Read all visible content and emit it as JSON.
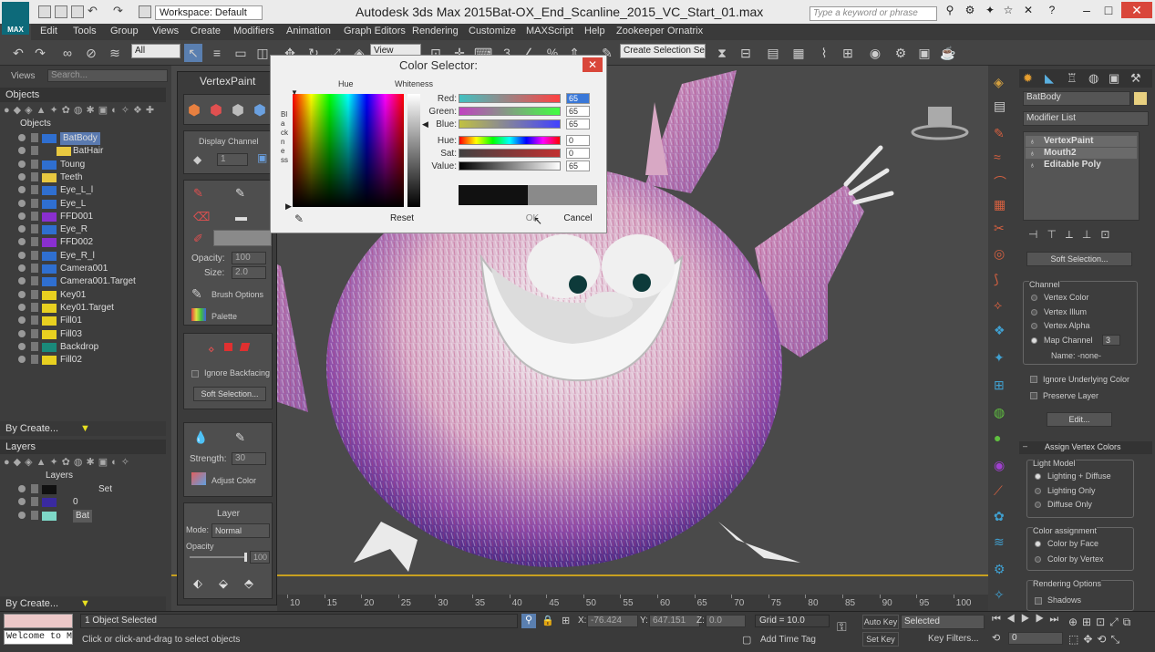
{
  "titlebar": {
    "app_title": "Autodesk 3ds Max 2015",
    "file_title": "Bat-OX_End_Scanline_2015_VC_Start_01.max",
    "logo_text": "MAX",
    "workspace": "Workspace: Default",
    "search_placeholder": "Type a keyword or phrase"
  },
  "menubar": [
    "Edit",
    "Tools",
    "Group",
    "Views",
    "Create",
    "Modifiers",
    "Animation",
    "Graph Editors",
    "Rendering",
    "Customize",
    "MAXScript",
    "Help",
    "Zookeeper",
    "Ornatrix"
  ],
  "toolbar": {
    "filter_select": "All",
    "view_select": "View",
    "selection_set": "Create Selection Se"
  },
  "scene_explorer": {
    "views_label": "Views",
    "search_placeholder": "Search...",
    "objects_tab": "Objects",
    "root": "Objects",
    "items": [
      {
        "label": "BatBody",
        "color": "#2f6fd0",
        "selected": true
      },
      {
        "label": "BatHair",
        "color": "#e8c840",
        "selected": false
      },
      {
        "label": "Toung",
        "color": "#2f6fd0",
        "selected": false
      },
      {
        "label": "Teeth",
        "color": "#e8c840",
        "selected": false
      },
      {
        "label": "Eye_L_l",
        "color": "#2f6fd0",
        "selected": false
      },
      {
        "label": "Eye_L",
        "color": "#2f6fd0",
        "selected": false
      },
      {
        "label": "FFD001",
        "color": "#8a2fd0",
        "selected": false
      },
      {
        "label": "Eye_R",
        "color": "#2f6fd0",
        "selected": false
      },
      {
        "label": "FFD002",
        "color": "#8a2fd0",
        "selected": false
      },
      {
        "label": "Eye_R_l",
        "color": "#2f6fd0",
        "selected": false
      },
      {
        "label": "Camera001",
        "color": "#2f6fd0",
        "selected": false
      },
      {
        "label": "Camera001.Target",
        "color": "#2f6fd0",
        "selected": false
      },
      {
        "label": "Key01",
        "color": "#e8d020",
        "selected": false
      },
      {
        "label": "Key01.Target",
        "color": "#e8d020",
        "selected": false
      },
      {
        "label": "Fill01",
        "color": "#e8d020",
        "selected": false
      },
      {
        "label": "Fill03",
        "color": "#e8d020",
        "selected": false
      },
      {
        "label": "Backdrop",
        "color": "#1a8a7a",
        "selected": false
      },
      {
        "label": "Fill02",
        "color": "#e8d020",
        "selected": false
      }
    ],
    "by_create": "By Create...",
    "layers_title": "Layers",
    "layers_root": "Layers",
    "layers": [
      {
        "label": "Set",
        "color": "#111111"
      },
      {
        "label": "0",
        "color": "#3a2aa0"
      },
      {
        "label": "Bat",
        "color": "#7ed8c8"
      }
    ],
    "by_create_2": "By Create..."
  },
  "vertexpaint": {
    "title": "VertexPaint",
    "display_channel": "Display Channel",
    "channel_value": "1",
    "opacity_label": "Opacity:",
    "opacity_value": "100",
    "size_label": "Size:",
    "size_value": "2.0",
    "brush_options": "Brush Options",
    "palette": "Palette",
    "ignore_backfacing": "Ignore Backfacing",
    "soft_selection": "Soft Selection...",
    "strength_label": "Strength:",
    "strength_value": "30",
    "adjust_color": "Adjust Color",
    "layer_title": "Layer",
    "mode_label": "Mode:",
    "mode_value": "Normal",
    "layer_opacity_label": "Opacity",
    "layer_opacity_value": "100"
  },
  "color_selector": {
    "title": "Color Selector:",
    "hue_label": "Hue",
    "whiteness_label": "Whiteness",
    "blackness_label": "Blackness",
    "red_label": "Red:",
    "green_label": "Green:",
    "blue_label": "Blue:",
    "hue2_label": "Hue:",
    "sat_label": "Sat:",
    "value_label": "Value:",
    "red": "65",
    "green": "65",
    "blue": "65",
    "hue": "0",
    "sat": "0",
    "value": "65",
    "reset": "Reset",
    "ok": "OK",
    "cancel": "Cancel",
    "old_color": "#111111",
    "new_color": "#8a8a8a"
  },
  "modify_panel": {
    "object_name": "BatBody",
    "object_color": "#e8d080",
    "modifier_list": "Modifier List",
    "stack": [
      "VertexPaint",
      "Mouth2",
      "Editable Poly"
    ],
    "soft_selection_btn": "Soft Selection...",
    "channel_title": "Channel",
    "channels": [
      {
        "label": "Vertex Color",
        "on": false
      },
      {
        "label": "Vertex Illum",
        "on": false
      },
      {
        "label": "Vertex Alpha",
        "on": false
      },
      {
        "label": "Map Channel",
        "on": true
      }
    ],
    "map_channel_value": "3",
    "name_label": "Name: -none-",
    "ignore_underlying": "Ignore Underlying Color",
    "preserve_layer": "Preserve Layer",
    "edit_btn": "Edit...",
    "assign_title": "Assign Vertex Colors",
    "light_model_title": "Light Model",
    "light_models": [
      {
        "label": "Lighting + Diffuse",
        "on": true
      },
      {
        "label": "Lighting Only",
        "on": false
      },
      {
        "label": "Diffuse Only",
        "on": false
      }
    ],
    "color_assign_title": "Color assignment",
    "color_assign": [
      {
        "label": "Color by Face",
        "on": true
      },
      {
        "label": "Color by Vertex",
        "on": false
      }
    ],
    "render_opts_title": "Rendering Options",
    "shadows": "Shadows"
  },
  "timeline": {
    "ticks": [
      "10",
      "15",
      "20",
      "25",
      "30",
      "35",
      "40",
      "45",
      "50",
      "55",
      "60",
      "65",
      "70",
      "75",
      "80",
      "85",
      "90",
      "95",
      "100"
    ]
  },
  "status": {
    "maxscript": "Welcome to M",
    "selected_count": "1 Object Selected",
    "prompt": "Click or click-and-drag to select objects",
    "x_label": "X:",
    "x_value": "-76.424",
    "y_label": "Y:",
    "y_value": "647.151",
    "z_label": "Z:",
    "z_value": "0.0",
    "grid": "Grid = 10.0",
    "add_time_tag": "Add Time Tag",
    "auto_key": "Auto Key",
    "auto_key_value": "Selected",
    "set_key": "Set Key",
    "key_filters": "Key Filters...",
    "frame": "0"
  }
}
